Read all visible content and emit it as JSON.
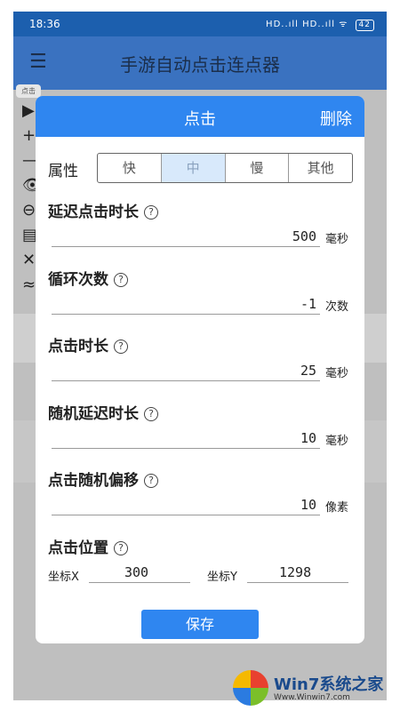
{
  "statusbar": {
    "time": "18:36",
    "signal": "HD..ıll HD..ıll ᯤ",
    "battery": "42"
  },
  "appbar": {
    "title": "手游自动点击连点器",
    "menu_icon": "☰"
  },
  "mini_chip": "点击",
  "side_icons": [
    "▶",
    "+",
    "—",
    "👁",
    "⊖",
    "▤",
    "✕",
    "≈"
  ],
  "modal": {
    "title": "点击",
    "delete_label": "删除",
    "property_label": "属性",
    "speed_options": [
      "快",
      "中",
      "慢",
      "其他"
    ],
    "selected_speed": "中",
    "fields": [
      {
        "label": "延迟点击时长",
        "value": "500",
        "unit": "毫秒"
      },
      {
        "label": "循环次数",
        "value": "-1",
        "unit": "次数"
      },
      {
        "label": "点击时长",
        "value": "25",
        "unit": "毫秒"
      },
      {
        "label": "随机延迟时长",
        "value": "10",
        "unit": "毫秒"
      },
      {
        "label": "点击随机偏移",
        "value": "10",
        "unit": "像素"
      }
    ],
    "position": {
      "label": "点击位置",
      "x_label": "坐标X",
      "x_value": "300",
      "y_label": "坐标Y",
      "y_value": "1298"
    },
    "save_label": "保存",
    "help_glyph": "?"
  },
  "watermark": {
    "brand": "Win7系统之家",
    "url": "Www.Winwin7.com"
  },
  "colors": {
    "primary": "#2f86f0",
    "appbar": "#3a72c0",
    "statusbar": "#1c5fae"
  }
}
